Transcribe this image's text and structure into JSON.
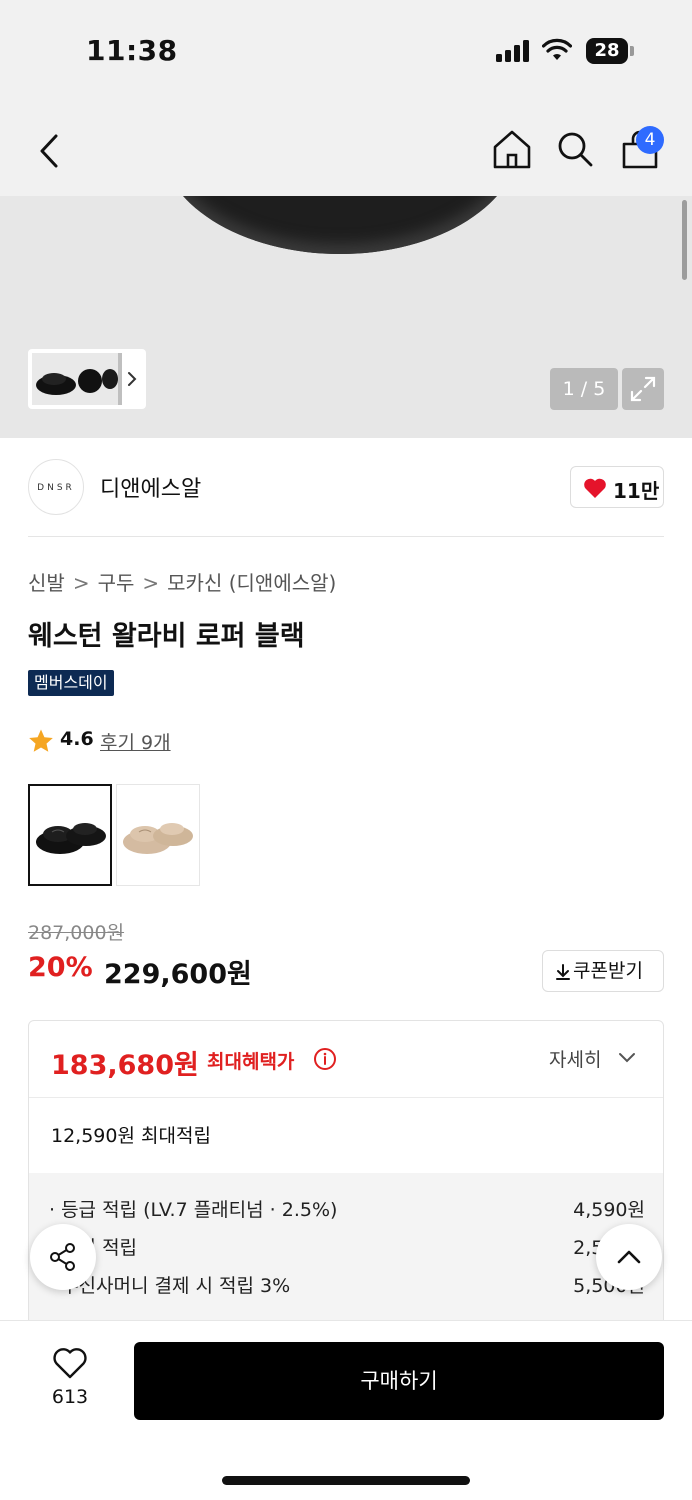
{
  "status_bar": {
    "time": "11:38",
    "battery": "28"
  },
  "header": {
    "cart_count": "4"
  },
  "gallery": {
    "counter": "1 / 5"
  },
  "brand": {
    "logo_text": "DNSR",
    "name": "디앤에스알",
    "likes": "11만"
  },
  "product": {
    "breadcrumb": [
      "신발",
      "구두",
      "모카신 (디앤에스알)"
    ],
    "title": "웨스턴 왈라비 로퍼 블랙",
    "badge": "멤버스데이",
    "rating": "4.6",
    "review_link": "후기 9개",
    "options": [
      {
        "name": "black",
        "selected": true
      },
      {
        "name": "beige",
        "selected": false
      }
    ]
  },
  "price": {
    "original": "287,000원",
    "discount": "20%",
    "sale": "229,600원",
    "coupon_button": "쿠폰받기"
  },
  "benefit": {
    "max_price": "183,680원",
    "max_label": "최대혜택가",
    "detail_button": "자세히",
    "points_summary": "12,590원 최대적립",
    "rows": [
      {
        "label": "· 등급 적립 (LV.7 플래티넘 · 2.5%)",
        "value": "4,590원"
      },
      {
        "label": "· 후기 적립",
        "value": "2,500원"
      },
      {
        "label": "· 무신사머니 결제 시 적립 3%",
        "value": "5,500원"
      }
    ]
  },
  "bottom_bar": {
    "wish_count": "613",
    "buy_button": "구매하기"
  },
  "colors": {
    "accent_red": "#e02020",
    "badge_navy": "#0d2a53",
    "cart_badge": "#2f6bff",
    "buy_button": "#000000"
  }
}
